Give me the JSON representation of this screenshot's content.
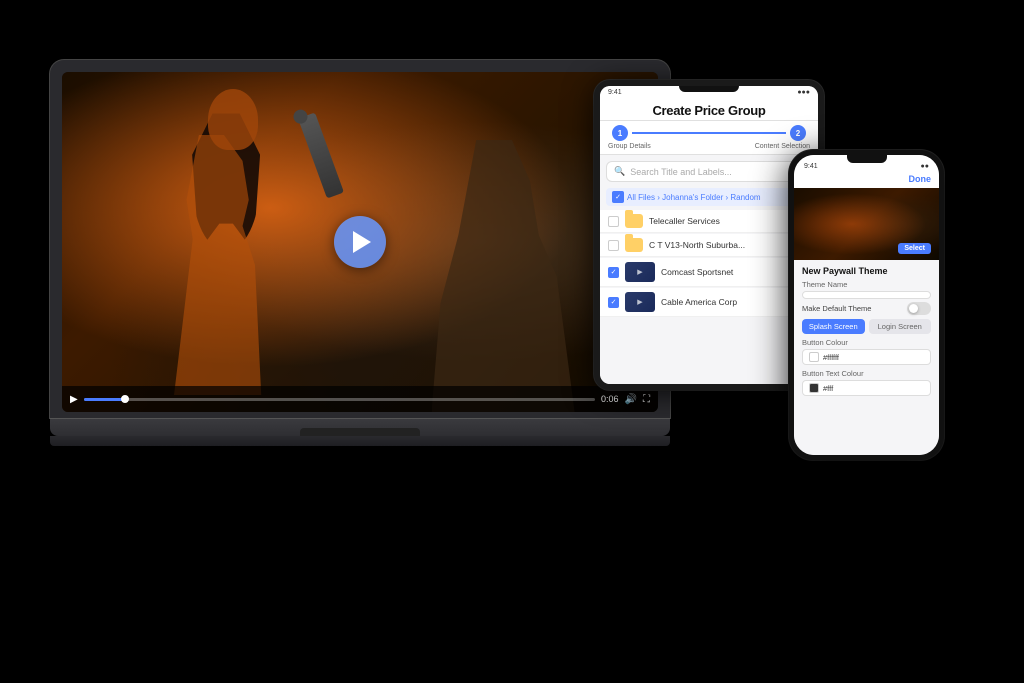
{
  "scene": {
    "bg": "#000000"
  },
  "laptop": {
    "video": {
      "play_hint": "Play video",
      "time": "0:06",
      "progress_pct": 8
    },
    "controls": {
      "play_label": "▶",
      "volume_label": "🔊",
      "fullscreen_label": "⛶",
      "time_display": "0:06"
    }
  },
  "tablet": {
    "title": "Create Price Group",
    "status_left": "9:41",
    "status_right": "●●●",
    "stepper": {
      "step1_label": "Group Details",
      "step2_label": "Content Selection",
      "step1_num": "1",
      "step2_num": "2"
    },
    "search": {
      "placeholder": "Search Title and Labels..."
    },
    "breadcrumb": "All Files › Johanna's Folder › Random",
    "files": [
      {
        "name": "Telecaller Services",
        "type": "folder",
        "checked": false
      },
      {
        "name": "C T V13-North Suburba...",
        "type": "folder",
        "checked": false
      },
      {
        "name": "Comcast Sportsnet",
        "type": "video",
        "checked": true
      },
      {
        "name": "Cable America Corp",
        "type": "video",
        "checked": true
      }
    ]
  },
  "phone": {
    "status_left": "9:41",
    "status_right": "●●",
    "done_label": "Done",
    "section_heading": "New Paywall Theme",
    "fields": {
      "theme_name_label": "Theme Name",
      "theme_name_value": "",
      "default_theme_label": "Make Default Theme"
    },
    "tabs": {
      "splash_label": "Splash Screen",
      "login_label": "Login Screen"
    },
    "button_color_label": "Button Colour",
    "button_color_value": "#ffffff",
    "button_text_color_label": "Button Text Colour",
    "button_text_color_value": "#fff"
  }
}
